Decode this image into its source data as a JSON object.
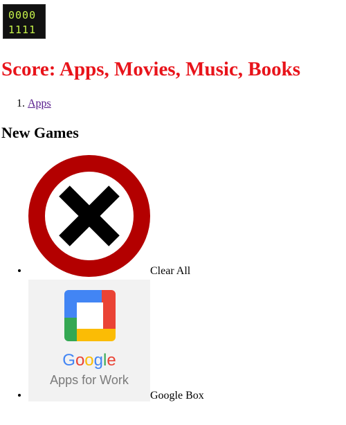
{
  "logo": {
    "row1": "0000",
    "row2": "1111",
    "color": "#c6f24a"
  },
  "header": {
    "title": "Score: Apps, Movies, Music, Books"
  },
  "breadcrumb": {
    "items": [
      {
        "label": "Apps"
      }
    ]
  },
  "section": {
    "title": "New Games"
  },
  "games": [
    {
      "label": "Clear All",
      "icon": "clear-all-icon"
    },
    {
      "label": "Google Box",
      "icon": "google-apps-for-work-icon",
      "logo_word": "Google",
      "logo_sub": "Apps for Work"
    }
  ],
  "colors": {
    "title": "#e8141b",
    "no_sign_ring": "#b30000",
    "link": "#551a8b"
  }
}
